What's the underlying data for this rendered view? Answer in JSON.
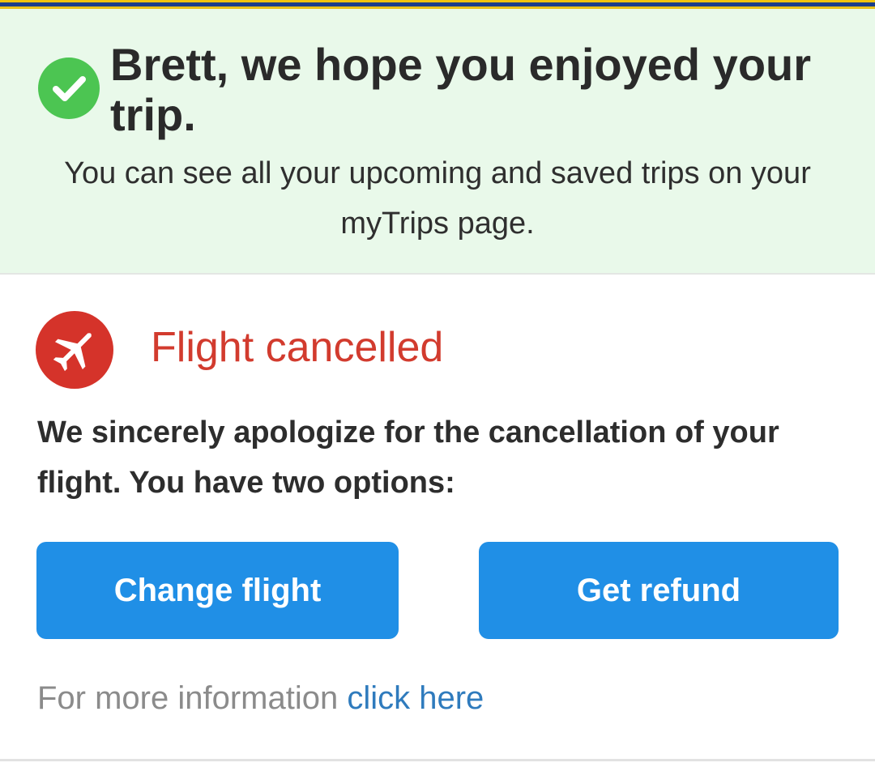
{
  "banner": {
    "title": "Brett, we hope you enjoyed your trip.",
    "message": "You can see all your upcoming and saved trips on your myTrips page.",
    "icon": "check-circle-icon",
    "icon_color": "#4cc552",
    "background_color": "#e9f9ea"
  },
  "cancellation": {
    "icon": "airplane-icon",
    "icon_color": "#d5332a",
    "title": "Flight cancelled",
    "title_color": "#d23b2e",
    "message": "We sincerely apologize for the cancellation of your flight. You have two options:",
    "buttons": {
      "change_label": "Change flight",
      "refund_label": "Get refund",
      "color": "#208fe6"
    },
    "more_info": {
      "prefix": "For more information",
      "link_label": "click here"
    }
  }
}
